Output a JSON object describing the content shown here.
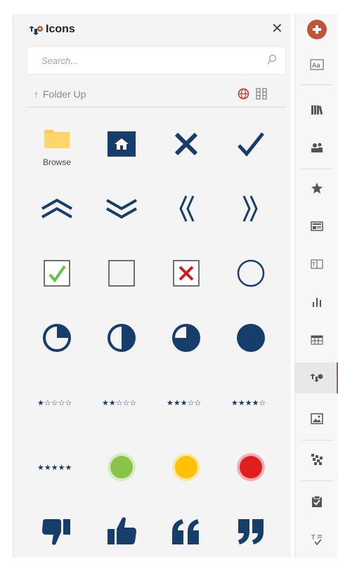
{
  "panel": {
    "title": "Icons",
    "search_placeholder": "Search...",
    "folder_up_label": "Folder Up",
    "browse_label": "Browse"
  },
  "icons": [
    "browse-folder-icon",
    "home-icon",
    "x-mark-icon",
    "check-mark-icon",
    "double-chevron-up-icon",
    "double-chevron-down-icon",
    "double-chevron-left-icon",
    "double-chevron-right-icon",
    "checked-checkbox-icon",
    "empty-checkbox-icon",
    "x-checkbox-icon",
    "empty-circle-icon",
    "pie-quarter-icon",
    "pie-half-icon",
    "pie-three-quarter-icon",
    "pie-full-icon",
    "one-star-rating-icon",
    "two-star-rating-icon",
    "three-star-rating-icon",
    "four-star-rating-icon",
    "five-star-rating-icon",
    "green-status-light-icon",
    "yellow-status-light-icon",
    "red-status-light-icon",
    "thumbs-down-icon",
    "thumbs-up-icon",
    "open-quote-icon",
    "close-quote-icon"
  ],
  "toolbar": [
    "main-menu-icon",
    "text-style-icon",
    "library-icon",
    "people-icon",
    "star-icon",
    "card-icon",
    "text-field-icon",
    "bar-chart-icon",
    "table-icon",
    "icons-panel-icon",
    "image-icon",
    "pattern-icon",
    "clipboard-check-icon",
    "text-format-icon"
  ],
  "colors": {
    "navy": "#173d6b",
    "accent": "#c0533a",
    "green": "#8bc34a",
    "yellow": "#ffc107",
    "red": "#e01e1e"
  }
}
